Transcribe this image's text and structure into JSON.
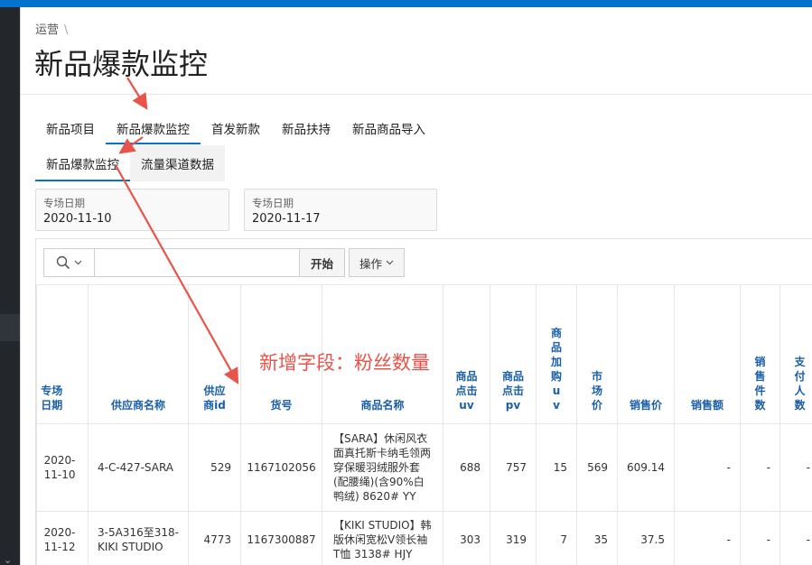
{
  "breadcrumb": {
    "item": "运营",
    "separator": "\\"
  },
  "page_title": "新品爆款监控",
  "tabs_primary": [
    {
      "label": "新品项目"
    },
    {
      "label": "新品爆款监控"
    },
    {
      "label": "首发新款"
    },
    {
      "label": "新品扶持"
    },
    {
      "label": "新品商品导入"
    }
  ],
  "tabs_secondary": [
    {
      "label": "新品爆款监控"
    },
    {
      "label": "流量渠道数据"
    }
  ],
  "filters": {
    "start": {
      "label": "专场日期",
      "value": "2020-11-10"
    },
    "end": {
      "label": "专场日期",
      "value": "2020-11-17"
    }
  },
  "toolbar": {
    "search_value": "",
    "go_label": "开始",
    "actions_label": "操作"
  },
  "table": {
    "headers": [
      "专场日期",
      "供应商名称",
      "供应商id",
      "货号",
      "商品名称",
      "商品点击uv",
      "商品点击pv",
      "商品加购uv",
      "市场价",
      "销售价",
      "销售额",
      "销售件数",
      "支付人数"
    ],
    "rows": [
      [
        "2020-11-10",
        "4-C-427-SARA",
        "529",
        "1167102056",
        "【SARA】休闲风衣面真托斯卡纳毛领两穿保暖羽绒服外套(配腰绳)(含90%白鸭绒) 8620# YY",
        "688",
        "757",
        "15",
        "569",
        "609.14",
        "-",
        "-",
        "-"
      ],
      [
        "2020-11-12",
        "3-5A316至318-KIKI STUDIO",
        "4773",
        "1167300887",
        "【KIKI STUDIO】韩版休闲宽松V领长袖T恤 3138# HJY",
        "303",
        "319",
        "7",
        "35",
        "37.5",
        "-",
        "-",
        "-"
      ]
    ]
  },
  "annotation": "新增字段：粉丝数量",
  "colors": {
    "accent": "#0572ce",
    "header_text": "#1a5fa8",
    "annotation": "#e8534a"
  }
}
